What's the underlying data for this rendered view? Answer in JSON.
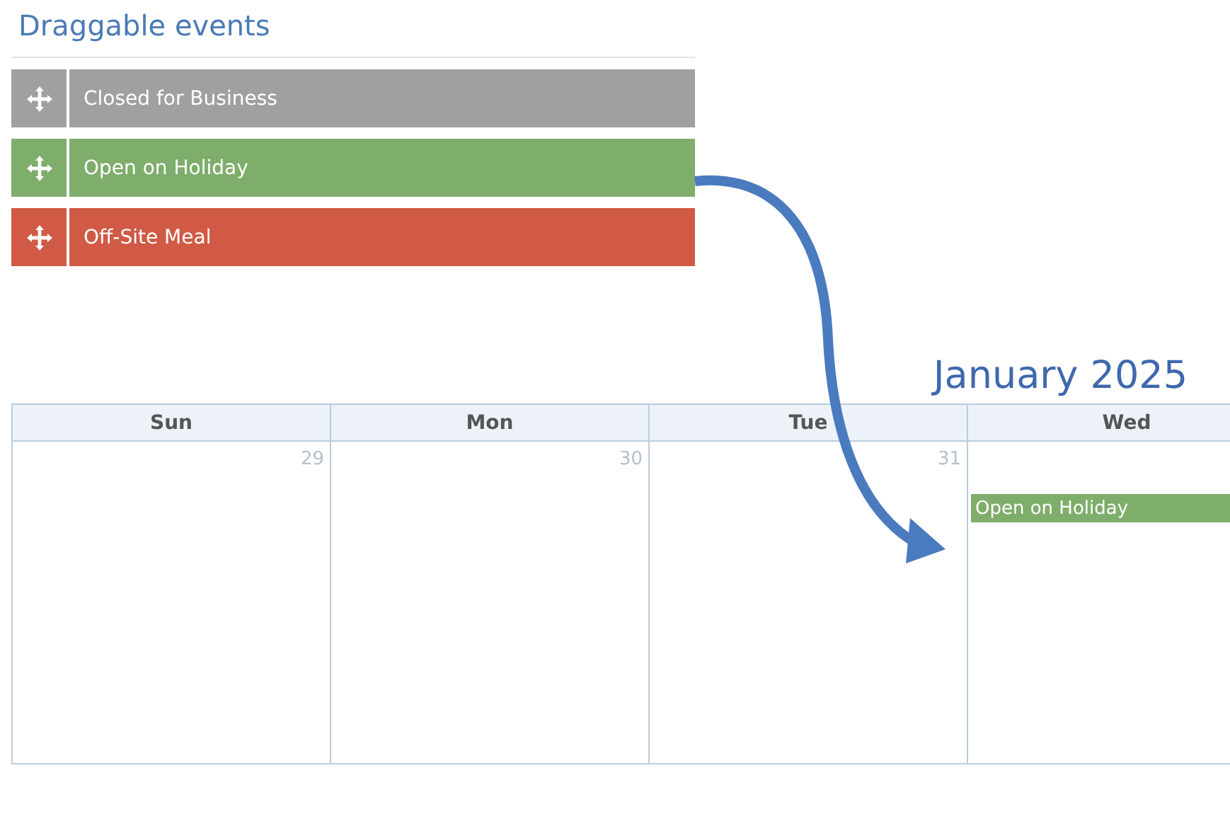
{
  "panel": {
    "title": "Draggable events"
  },
  "events": [
    {
      "label": "Closed for Business",
      "color": "#a0a0a0"
    },
    {
      "label": "Open on Holiday",
      "color": "#7fad6b"
    },
    {
      "label": "Off-Site Meal",
      "color": "#d05a45"
    }
  ],
  "calendar": {
    "title": "January 2025",
    "columns": [
      {
        "day": "Sun",
        "date": "29"
      },
      {
        "day": "Mon",
        "date": "30"
      },
      {
        "day": "Tue",
        "date": "31"
      },
      {
        "day": "Wed",
        "events": [
          {
            "label": "Open on Holiday",
            "color": "#7fad6b"
          }
        ]
      }
    ]
  }
}
